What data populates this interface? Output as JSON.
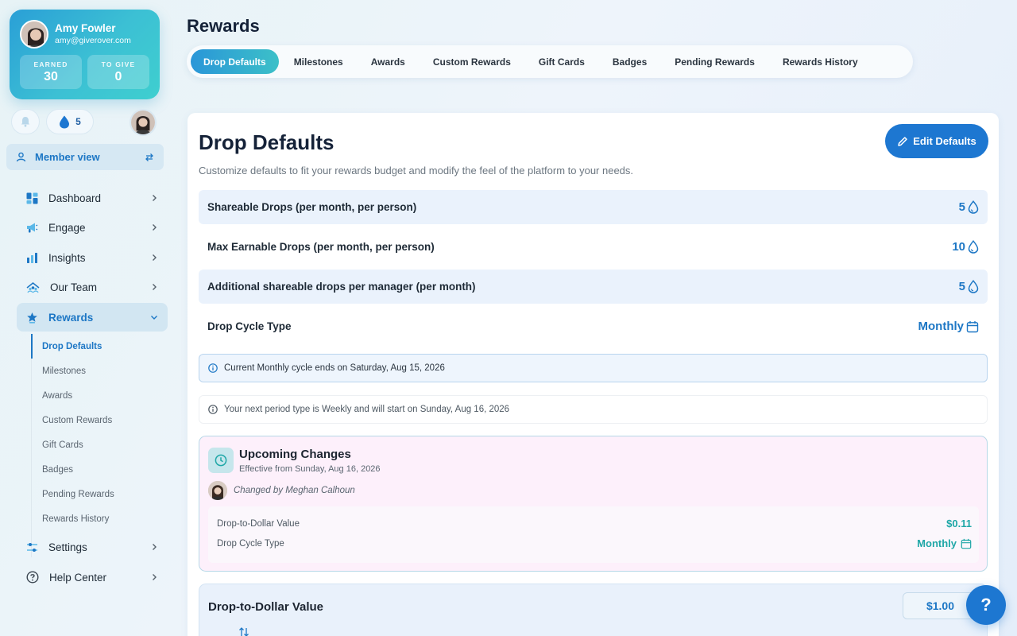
{
  "user": {
    "name": "Amy Fowler",
    "email": "amy@giverover.com",
    "earned_label": "EARNED",
    "earned_value": "30",
    "to_give_label": "TO GIVE",
    "to_give_value": "0"
  },
  "quick": {
    "drop_count": "5"
  },
  "member_view": {
    "label": "Member view"
  },
  "nav": {
    "items": [
      {
        "label": "Dashboard",
        "icon": "dashboard-icon"
      },
      {
        "label": "Engage",
        "icon": "megaphone-icon"
      },
      {
        "label": "Insights",
        "icon": "bar-chart-icon"
      },
      {
        "label": "Our Team",
        "icon": "team-icon"
      },
      {
        "label": "Rewards",
        "icon": "star-icon"
      },
      {
        "label": "Settings",
        "icon": "sliders-icon"
      },
      {
        "label": "Help Center",
        "icon": "help-circle-icon"
      }
    ],
    "rewards_sub": [
      "Drop Defaults",
      "Milestones",
      "Awards",
      "Custom Rewards",
      "Gift Cards",
      "Badges",
      "Pending Rewards",
      "Rewards History"
    ]
  },
  "header": {
    "title": "Rewards",
    "tabs": [
      "Drop Defaults",
      "Milestones",
      "Awards",
      "Custom Rewards",
      "Gift Cards",
      "Badges",
      "Pending Rewards",
      "Rewards History"
    ]
  },
  "main": {
    "title": "Drop Defaults",
    "description": "Customize defaults to fit your rewards budget and modify the feel of the platform to your needs.",
    "edit_label": "Edit Defaults",
    "settings": [
      {
        "label": "Shareable Drops (per month, per person)",
        "value": "5"
      },
      {
        "label": "Max Earnable Drops (per month, per person)",
        "value": "10"
      },
      {
        "label": "Additional shareable drops per manager (per month)",
        "value": "5"
      },
      {
        "label": "Drop Cycle Type",
        "value": "Monthly"
      }
    ],
    "info_current": "Current Monthly cycle ends on Saturday, Aug 15, 2026",
    "info_next": "Your next period type is Weekly and will start on Sunday, Aug 16, 2026",
    "upcoming": {
      "title": "Upcoming Changes",
      "effective": "Effective from Sunday, Aug 16, 2026",
      "changed_by": "Changed by Meghan Calhoun",
      "changes": [
        {
          "label": "Drop-to-Dollar Value",
          "value": "$0.11"
        },
        {
          "label": "Drop Cycle Type",
          "value": "Monthly"
        }
      ]
    },
    "drop_to_dollar": {
      "label": "Drop-to-Dollar Value",
      "value": "$1.00"
    }
  },
  "help": {
    "label": "?"
  },
  "colors": {
    "accent": "#1d77d1",
    "teal": "#1fa7a7",
    "active_nav_bg": "#d2e6f2",
    "upcoming_bg": "#fdf0fb"
  }
}
